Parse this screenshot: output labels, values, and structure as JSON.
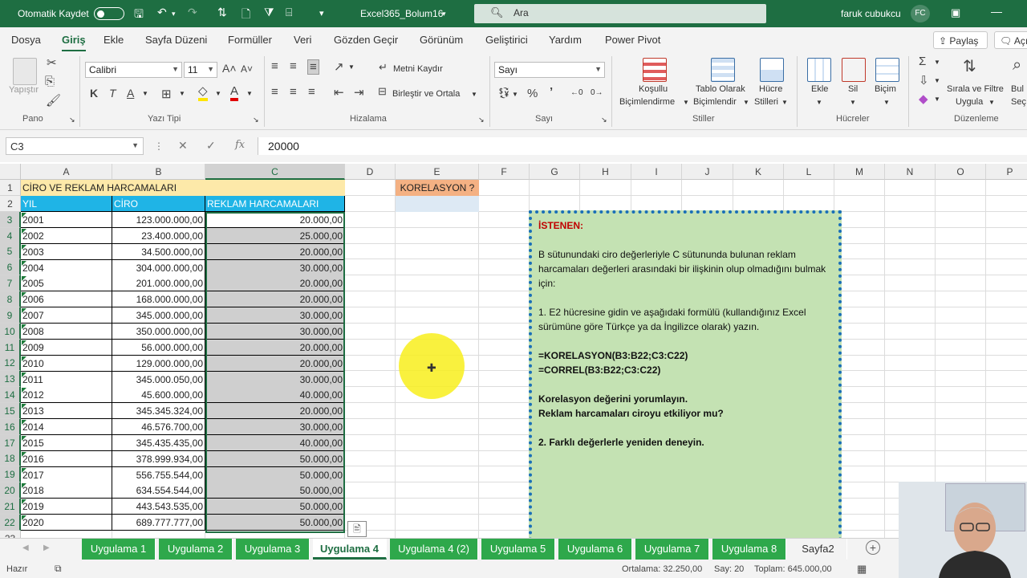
{
  "titlebar": {
    "autosave_label": "Otomatik Kaydet",
    "file_name": "Excel365_Bolum16",
    "search_placeholder": "Ara",
    "user_name": "faruk cubukcu",
    "user_initials": "FC"
  },
  "menu": {
    "tabs": [
      "Dosya",
      "Giriş",
      "Ekle",
      "Sayfa Düzeni",
      "Formüller",
      "Veri",
      "Gözden Geçir",
      "Görünüm",
      "Geliştirici",
      "Yardım",
      "Power Pivot"
    ],
    "share_label": "Paylaş",
    "comments_label": "Açı"
  },
  "ribbon": {
    "pano": {
      "paste_label": "Yapıştır",
      "group_label": "Pano"
    },
    "font": {
      "font_name": "Calibri",
      "font_size": "11",
      "group_label": "Yazı Tipi",
      "bold": "K",
      "italic": "T",
      "underline": "A"
    },
    "align": {
      "wrap_label": "Metni Kaydır",
      "merge_label": "Birleştir ve Ortala",
      "group_label": "Hizalama"
    },
    "number": {
      "format": "Sayı",
      "group_label": "Sayı"
    },
    "styles": {
      "conditional_label1": "Koşullu",
      "conditional_label2": "Biçimlendirme",
      "table_label1": "Tablo Olarak",
      "table_label2": "Biçimlendir",
      "cell_styles1": "Hücre",
      "cell_styles2": "Stilleri",
      "group_label": "Stiller"
    },
    "cells": {
      "insert_label": "Ekle",
      "delete_label": "Sil",
      "format_label": "Biçim",
      "group_label": "Hücreler"
    },
    "editing": {
      "sort_label1": "Sırala ve Filtre",
      "sort_label2": "Uygula",
      "find_label1": "Bul",
      "find_label2": "Seç",
      "group_label": "Düzenleme"
    }
  },
  "formula_bar": {
    "name_box": "C3",
    "formula": "20000"
  },
  "grid": {
    "columns": [
      "A",
      "B",
      "C",
      "D",
      "E",
      "F",
      "G",
      "H",
      "I",
      "J",
      "K",
      "L",
      "M",
      "N",
      "O",
      "P"
    ],
    "header_row": {
      "title": "CİRO VE REKLAM HARCAMALARI",
      "korelasyon": "KORELASYON ?"
    },
    "table_headers": [
      "YIL",
      "CİRO",
      "REKLAM HARCAMALARI"
    ],
    "rows": [
      {
        "yil": "2001",
        "ciro": "123.000.000,00",
        "reklam": "20.000,00"
      },
      {
        "yil": "2002",
        "ciro": "23.400.000,00",
        "reklam": "25.000,00"
      },
      {
        "yil": "2003",
        "ciro": "34.500.000,00",
        "reklam": "20.000,00"
      },
      {
        "yil": "2004",
        "ciro": "304.000.000,00",
        "reklam": "30.000,00"
      },
      {
        "yil": "2005",
        "ciro": "201.000.000,00",
        "reklam": "20.000,00"
      },
      {
        "yil": "2006",
        "ciro": "168.000.000,00",
        "reklam": "20.000,00"
      },
      {
        "yil": "2007",
        "ciro": "345.000.000,00",
        "reklam": "30.000,00"
      },
      {
        "yil": "2008",
        "ciro": "350.000.000,00",
        "reklam": "30.000,00"
      },
      {
        "yil": "2009",
        "ciro": "56.000.000,00",
        "reklam": "20.000,00"
      },
      {
        "yil": "2010",
        "ciro": "129.000.000,00",
        "reklam": "20.000,00"
      },
      {
        "yil": "2011",
        "ciro": "345.000.050,00",
        "reklam": "30.000,00"
      },
      {
        "yil": "2012",
        "ciro": "45.600.000,00",
        "reklam": "40.000,00"
      },
      {
        "yil": "2013",
        "ciro": "345.345.324,00",
        "reklam": "20.000,00"
      },
      {
        "yil": "2014",
        "ciro": "46.576.700,00",
        "reklam": "30.000,00"
      },
      {
        "yil": "2015",
        "ciro": "345.435.435,00",
        "reklam": "40.000,00"
      },
      {
        "yil": "2016",
        "ciro": "378.999.934,00",
        "reklam": "50.000,00"
      },
      {
        "yil": "2017",
        "ciro": "556.755.544,00",
        "reklam": "50.000,00"
      },
      {
        "yil": "2018",
        "ciro": "634.554.544,00",
        "reklam": "50.000,00"
      },
      {
        "yil": "2019",
        "ciro": "443.543.535,00",
        "reklam": "50.000,00"
      },
      {
        "yil": "2020",
        "ciro": "689.777.777,00",
        "reklam": "50.000,00"
      }
    ]
  },
  "note": {
    "title": "İSTENEN:",
    "p1": "B sütunundaki ciro değerleriyle C sütununda bulunan reklam harcamaları değerleri arasındaki bir ilişkinin olup olmadığını bulmak için:",
    "p2": "1. E2 hücresine gidin ve aşağıdaki formülü (kullandığınız Excel sürümüne göre Türkçe ya da İngilizce olarak) yazın.",
    "f1": "=KORELASYON(B3:B22;C3:C22)",
    "f2": "=CORREL(B3:B22;C3:C22)",
    "q1": "Korelasyon değerini yorumlayın.",
    "q2": "Reklam harcamaları ciroyu etkiliyor mu?",
    "p3": "2. Farklı değerlerle yeniden deneyin."
  },
  "sheets": [
    "Uygulama 1",
    "Uygulama 2",
    "Uygulama 3",
    "Uygulama 4",
    "Uygulama 4 (2)",
    "Uygulama 5",
    "Uygulama 6",
    "Uygulama 7",
    "Uygulama 8",
    "Sayfa2"
  ],
  "active_sheet_index": 3,
  "status": {
    "ready": "Hazır",
    "average": "Ortalama: 32.250,00",
    "count": "Say: 20",
    "sum": "Toplam: 645.000,00"
  },
  "colors": {
    "excel_green": "#1e6e42",
    "header_blue": "#1fb4e6",
    "title_fill": "#fde9a9",
    "korelasyon_fill": "#f4b183",
    "note_fill": "#c4e2b3",
    "note_border": "#1a6fb8",
    "selection_gray": "#cfcfcf"
  }
}
